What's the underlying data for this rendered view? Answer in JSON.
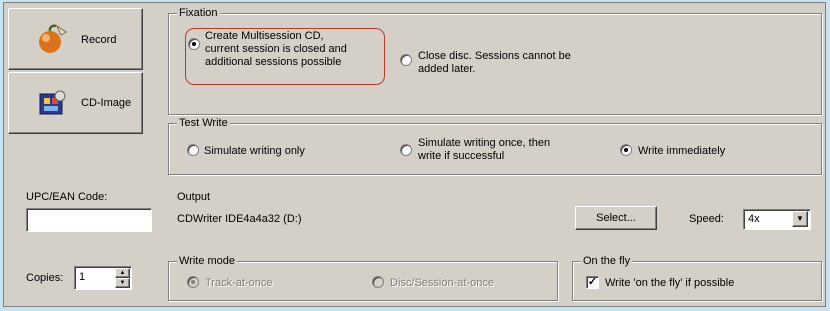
{
  "buttons": {
    "record_label": "Record",
    "cd_image_label": "CD-Image",
    "select_label": "Select..."
  },
  "fixation": {
    "title": "Fixation",
    "multisession_line1": "Create Multisession CD,",
    "multisession_line2": "current session is closed and",
    "multisession_line3": "additional sessions possible",
    "close_line1": "Close disc. Sessions cannot be",
    "close_line2": "added later.",
    "selected": "multisession"
  },
  "test_write": {
    "title": "Test Write",
    "simulate_only": "Simulate writing only",
    "simulate_once_line1": "Simulate writing once, then",
    "simulate_once_line2": "write if successful",
    "write_immediately": "Write immediately",
    "selected": "write_immediately"
  },
  "upc": {
    "label": "UPC/EAN Code:",
    "value": ""
  },
  "output": {
    "title": "Output",
    "device": "CDWriter IDE4a4a32 (D:)"
  },
  "speed": {
    "label": "Speed:",
    "value": "4x"
  },
  "copies": {
    "label": "Copies:",
    "value": "1"
  },
  "write_mode": {
    "title": "Write mode",
    "track_at_once": "Track-at-once",
    "disc_session_at_once": "Disc/Session-at-once",
    "selected": "track_at_once",
    "enabled": false
  },
  "on_the_fly": {
    "title": "On the fly",
    "option_label": "Write 'on the fly' if possible",
    "checked": true
  },
  "colors": {
    "background": "#c7e3f2",
    "dialog_face": "#d4d0c8",
    "highlight_outline": "#c0392b"
  }
}
